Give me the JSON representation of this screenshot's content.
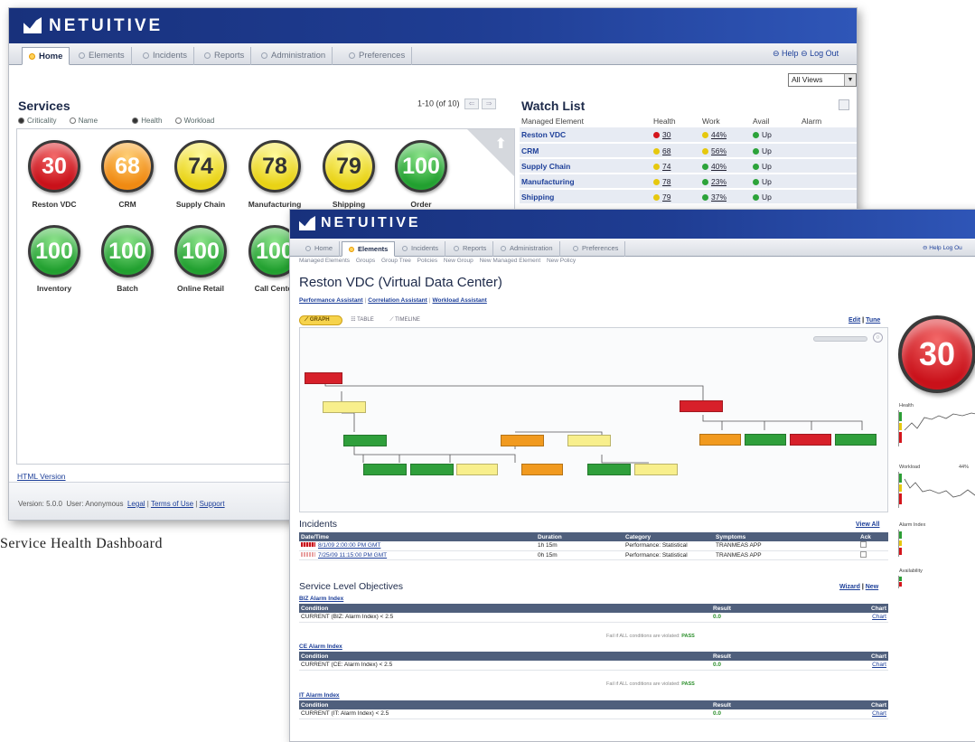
{
  "win1": {
    "brand": "NETUITIVE",
    "brand_mark": "™",
    "tabs": [
      {
        "label": "Home",
        "active": true
      },
      {
        "label": "Elements",
        "active": false
      },
      {
        "label": "Incidents",
        "active": false
      },
      {
        "label": "Reports",
        "active": false
      },
      {
        "label": "Administration",
        "active": false
      },
      {
        "label": "Preferences",
        "active": false
      }
    ],
    "help": "Help",
    "logout": "Log Out",
    "views_select": "All Views",
    "services": {
      "title": "Services",
      "sort": {
        "criticality": "Criticality",
        "name": "Name",
        "health": "Health",
        "workload": "Workload"
      },
      "pager": "1-10 (of 10)",
      "items": [
        {
          "value": "30",
          "label": "Reston VDC",
          "color": "#c9111a"
        },
        {
          "value": "68",
          "label": "CRM",
          "color": "#f08a12"
        },
        {
          "value": "74",
          "label": "Supply Chain",
          "color": "#e9d315"
        },
        {
          "value": "78",
          "label": "Manufacturing",
          "color": "#e9d315"
        },
        {
          "value": "79",
          "label": "Shipping",
          "color": "#e9d315"
        },
        {
          "value": "100",
          "label": "Order Processing",
          "color": "#22a030"
        },
        {
          "value": "100",
          "label": "Inventory",
          "color": "#22a030"
        },
        {
          "value": "100",
          "label": "Batch",
          "color": "#22a030"
        },
        {
          "value": "100",
          "label": "Online Retail",
          "color": "#22a030"
        },
        {
          "value": "100",
          "label": "Call Center",
          "color": "#22a030"
        }
      ]
    },
    "watch_list": {
      "title": "Watch List",
      "columns": [
        "Managed Element",
        "Health",
        "Work",
        "Avail",
        "Alarm"
      ],
      "rows": [
        {
          "element": "Reston VDC",
          "health": "30",
          "health_color": "red",
          "work": "44%",
          "work_color": "yellow",
          "avail": "Up"
        },
        {
          "element": "CRM",
          "health": "68",
          "health_color": "yellow",
          "work": "56%",
          "work_color": "yellow",
          "avail": "Up"
        },
        {
          "element": "Supply Chain",
          "health": "74",
          "health_color": "yellow",
          "work": "40%",
          "work_color": "green",
          "avail": "Up"
        },
        {
          "element": "Manufacturing",
          "health": "78",
          "health_color": "yellow",
          "work": "23%",
          "work_color": "green",
          "avail": "Up"
        },
        {
          "element": "Shipping",
          "health": "79",
          "health_color": "yellow",
          "work": "37%",
          "work_color": "green",
          "avail": "Up"
        }
      ]
    },
    "html_version": "HTML Version",
    "footer": {
      "version": "Version: 5.0.0",
      "user": "User: Anonymous",
      "legal": "Legal",
      "terms": "Terms of Use",
      "support": "Support"
    }
  },
  "caption": "Service Health Dashboard",
  "win2": {
    "brand": "NETUITIVE",
    "brand_mark": "™",
    "tabs": [
      {
        "label": "Home",
        "active": false
      },
      {
        "label": "Elements",
        "active": true
      },
      {
        "label": "Incidents",
        "active": false
      },
      {
        "label": "Reports",
        "active": false
      },
      {
        "label": "Administration",
        "active": false
      },
      {
        "label": "Preferences",
        "active": false
      }
    ],
    "help_logout": "Help  Log Ou",
    "subnav": [
      "Managed Elements",
      "Groups",
      "Group Tree",
      "Policies",
      "New Group",
      "New Managed Element",
      "New Policy"
    ],
    "title": "Reston VDC (Virtual Data Center)",
    "assistants": [
      "Performance Assistant",
      "Correlation Assistant",
      "Workload Assistant"
    ],
    "view_tabs": {
      "graph": "GRAPH",
      "table": "TABLE",
      "timeline": "TIMELINE"
    },
    "edit": "Edit",
    "tune": "Tune",
    "score": "30",
    "side_labels": {
      "health": "Health",
      "workload": "Workload",
      "workload_value": "44%",
      "alarm_index": "Alarm Index",
      "availability": "Availability"
    },
    "incidents": {
      "title": "Incidents",
      "view_all": "View All",
      "columns": [
        "Date/Time",
        "Duration",
        "Category",
        "Symptoms",
        "Ack"
      ],
      "rows": [
        {
          "datetime": "8/1/09 2:00:00 PM GMT",
          "duration": "1h 15m",
          "category": "Performance: Statistical",
          "symptoms": "TRANMEAS APP"
        },
        {
          "datetime": "7/25/09 11:15:00 PM GMT",
          "duration": "0h 15m",
          "category": "Performance: Statistical",
          "symptoms": "TRANMEAS APP"
        }
      ]
    },
    "slo": {
      "title": "Service Level Objectives",
      "wizard": "Wizard",
      "new": "New",
      "columns": [
        "Condition",
        "Result",
        "Chart"
      ],
      "fail_note": "Fail if ALL conditions are violated:",
      "pass": "PASS",
      "groups": [
        {
          "name": "BIZ Alarm Index",
          "condition": "CURRENT (BIZ: Alarm Index) < 2.5",
          "result": "0.0",
          "chart": "Chart"
        },
        {
          "name": "CE Alarm Index",
          "condition": "CURRENT (CE: Alarm Index) < 2.5",
          "result": "0.0",
          "chart": "Chart"
        },
        {
          "name": "IT Alarm Index",
          "condition": "CURRENT (IT: Alarm Index) < 2.5",
          "result": "0.0",
          "chart": "Chart"
        }
      ]
    }
  }
}
